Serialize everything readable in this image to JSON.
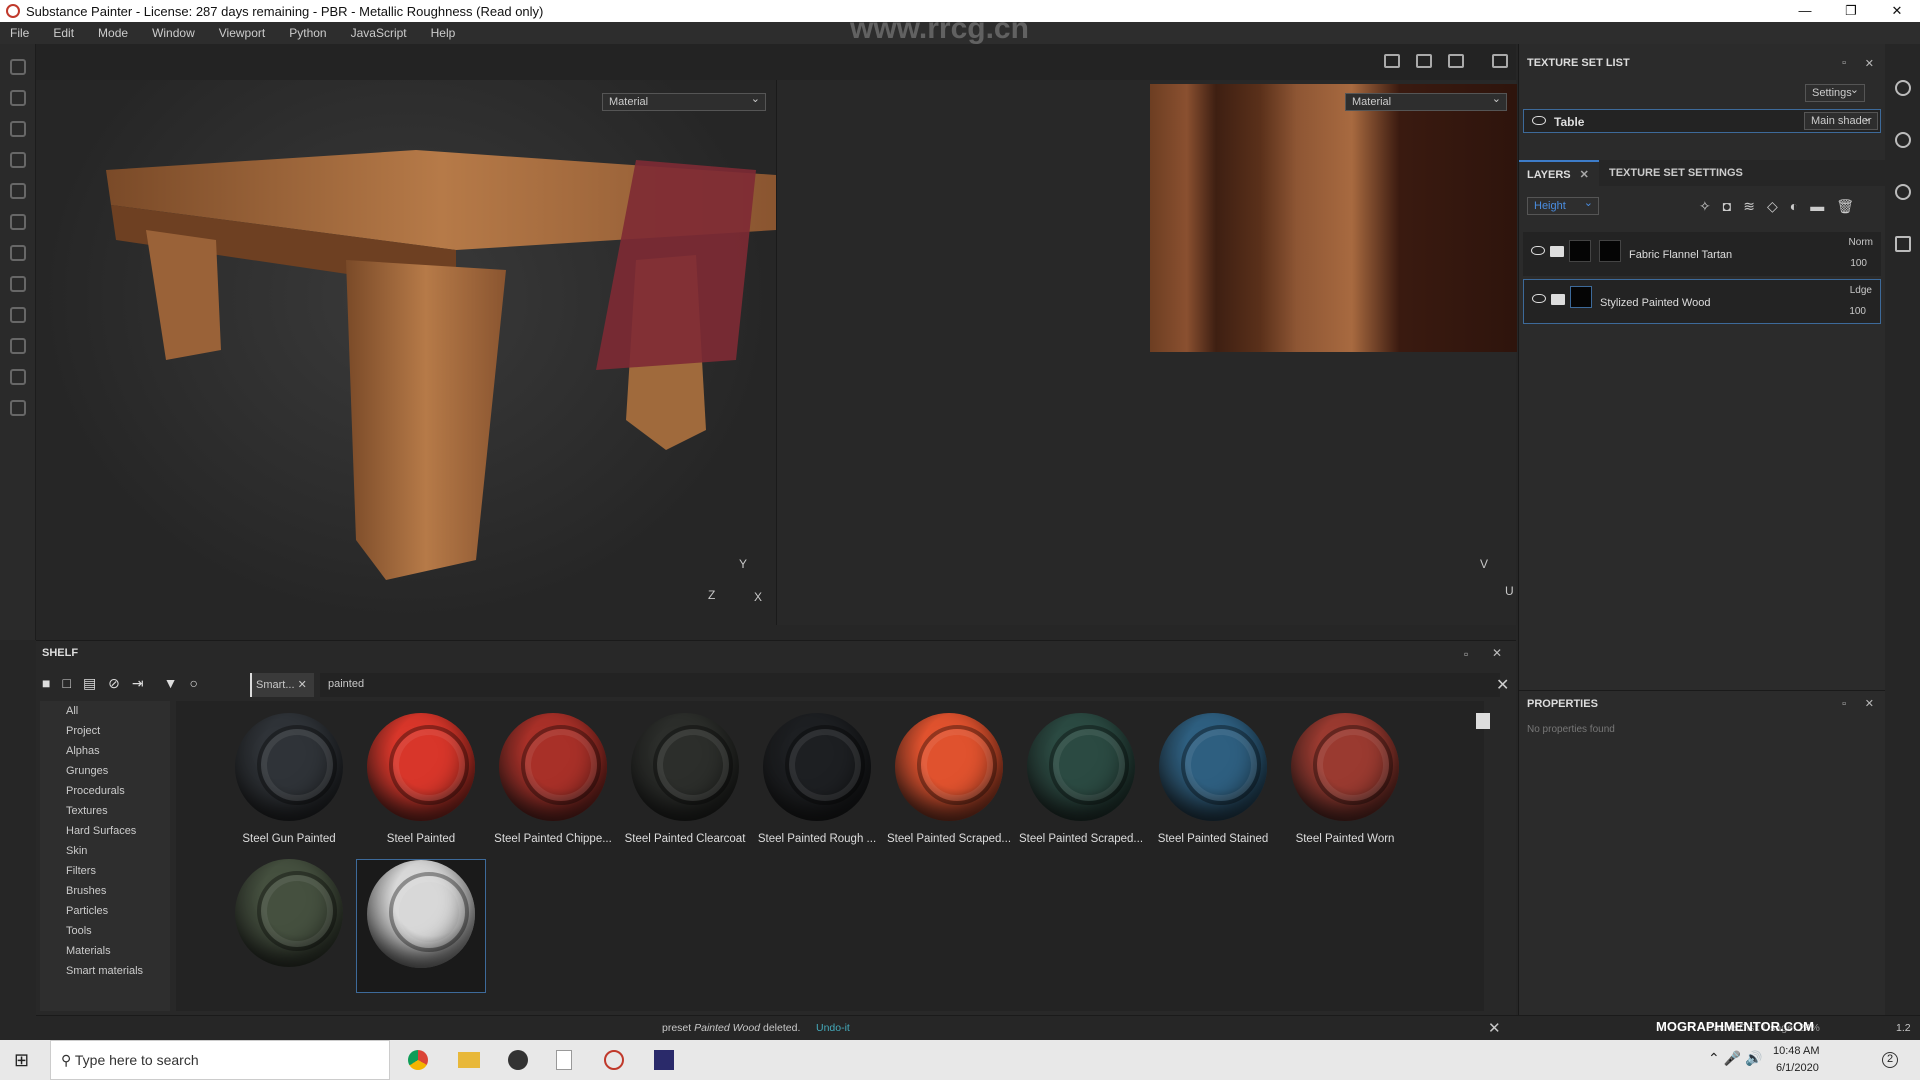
{
  "window": {
    "title": "Substance Painter - License: 287 days remaining - PBR - Metallic Roughness (Read only)",
    "controls": [
      "—",
      "❐",
      "✕"
    ]
  },
  "menu": [
    "File",
    "Edit",
    "Mode",
    "Window",
    "Viewport",
    "Python",
    "JavaScript",
    "Help"
  ],
  "viewport": {
    "left_mode": "Material",
    "right_mode": "Material",
    "axes3d": {
      "y": "Y",
      "z": "Z",
      "x": "X"
    },
    "axes2d": {
      "v": "V",
      "u": "U"
    }
  },
  "texture_set_list": {
    "title": "TEXTURE SET LIST",
    "settings_label": "Settings",
    "sets": [
      {
        "name": "Table",
        "shader": "Main shader"
      }
    ]
  },
  "layers": {
    "tabs": [
      "LAYERS",
      "TEXTURE SET SETTINGS"
    ],
    "active_tab": "LAYERS",
    "channel": "Height",
    "items": [
      {
        "name": "Fabric Flannel Tartan",
        "blend": "Norm",
        "opacity": "100"
      },
      {
        "name": "Stylized Painted Wood",
        "blend": "Ldge",
        "opacity": "100",
        "selected": true
      }
    ]
  },
  "properties": {
    "title": "PROPERTIES",
    "empty_text": "No properties found"
  },
  "shelf": {
    "title": "SHELF",
    "filter_tag": "Smart...",
    "search": "painted",
    "categories": [
      "All",
      "Project",
      "Alphas",
      "Grunges",
      "Procedurals",
      "Textures",
      "Hard Surfaces",
      "Skin",
      "Filters",
      "Brushes",
      "Particles",
      "Tools",
      "Materials",
      "Smart materials"
    ],
    "materials": [
      {
        "name": "Steel Gun Painted",
        "color": "#2f3338"
      },
      {
        "name": "Steel Painted",
        "color": "#d8362a"
      },
      {
        "name": "Steel Painted Chippe...",
        "color": "#a83028"
      },
      {
        "name": "Steel Painted Clearcoat",
        "color": "#2c2e2b"
      },
      {
        "name": "Steel Painted Rough ...",
        "color": "#1d1f22"
      },
      {
        "name": "Steel Painted Scraped...",
        "color": "#e0522e"
      },
      {
        "name": "Steel Painted Scraped...",
        "color": "#2b4a42"
      },
      {
        "name": "Steel Painted Stained",
        "color": "#2e5f80"
      },
      {
        "name": "Steel Painted Worn",
        "color": "#9a3a30"
      },
      {
        "name": "",
        "color": "#45503f"
      },
      {
        "name": "",
        "color": "#d8d8d8",
        "selected": true
      }
    ]
  },
  "status": {
    "message_prefix": "preset ",
    "message_italic": "Painted Wood",
    "message_suffix": " deleted.",
    "undo": "Undo-it",
    "cache": "Cache Disk Usage: 24%",
    "version": "1.2"
  },
  "taskbar": {
    "search_placeholder": "Type here to search",
    "time": "10:48 AM",
    "date": "6/1/2020",
    "notifications": "2"
  },
  "watermarks": [
    "www.rrcg.cn",
    "MOGRAPHMENTOR.COM"
  ]
}
